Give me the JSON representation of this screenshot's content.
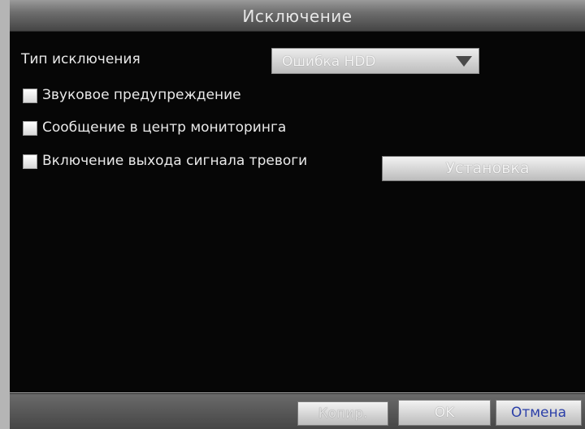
{
  "dialog": {
    "title": "Исключение"
  },
  "exception_type": {
    "label": "Тип исключения",
    "selected": "Ошибка HDD"
  },
  "options": {
    "audible_warning": {
      "label": "Звуковое предупреждение",
      "checked": false
    },
    "notify_center": {
      "label": "Сообщение в центр мониторинга",
      "checked": false
    },
    "alarm_output": {
      "label": "Включение выхода сигнала тревоги",
      "checked": false
    }
  },
  "buttons": {
    "setup": "Установка",
    "copy": "Копир.",
    "ok": "OK",
    "cancel": "Отмена"
  },
  "colors": {
    "panel_bg": "#060606",
    "frame_bg": "#b5b5b5",
    "cancel_text": "#2b3fa8"
  }
}
